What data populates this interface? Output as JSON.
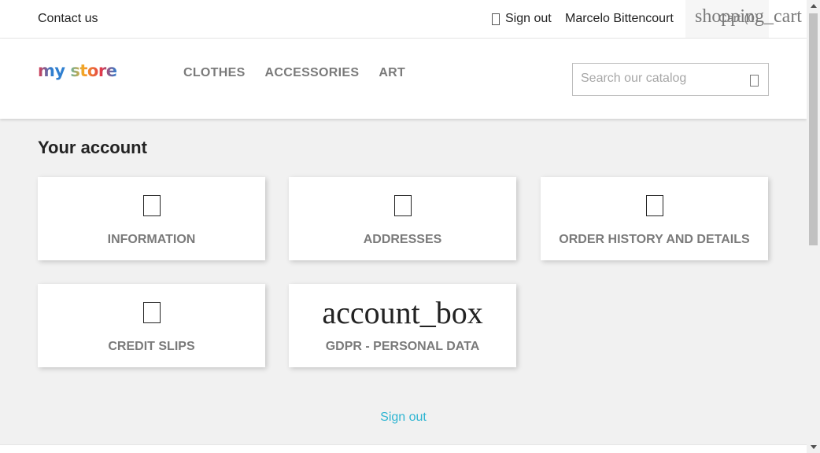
{
  "topbar": {
    "contact_label": "Contact us",
    "signout_label": "Sign out",
    "username": "Marcelo Bittencourt",
    "cart_icon_text": "shopping_cart",
    "cart_label": "Cart (0)"
  },
  "header": {
    "logo": {
      "part1": "my",
      "part2": " store"
    },
    "nav": [
      "CLOTHES",
      "ACCESSORIES",
      "ART"
    ],
    "search_placeholder": "Search our catalog",
    "search_icon": "search-icon"
  },
  "main": {
    "title": "Your account",
    "cards": [
      {
        "label": "INFORMATION",
        "icon": "person-icon"
      },
      {
        "label": "ADDRESSES",
        "icon": "location-icon"
      },
      {
        "label": "ORDER HISTORY AND DETAILS",
        "icon": "history-icon"
      },
      {
        "label": "CREDIT SLIPS",
        "icon": "receipt-icon"
      },
      {
        "label": "GDPR - PERSONAL DATA",
        "icon_text": "account_box"
      }
    ],
    "signout_link": "Sign out"
  },
  "colors": {
    "accent": "#2fb5d2",
    "background": "#f1f1f1",
    "muted_text": "#7a7a7a"
  }
}
